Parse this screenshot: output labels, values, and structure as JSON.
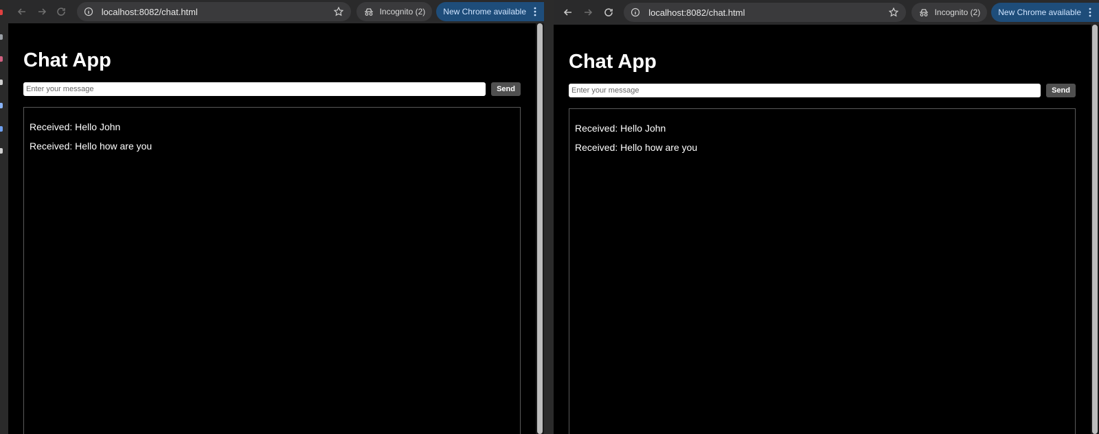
{
  "windows": [
    {
      "url": "localhost:8082/chat.html",
      "incognito_label": "Incognito (2)",
      "update_label": "New Chrome available",
      "app_title": "Chat App",
      "input_placeholder": "Enter your message",
      "send_label": "Send",
      "messages": [
        "Received: Hello John",
        "Received: Hello how are you"
      ]
    },
    {
      "url": "localhost:8082/chat.html",
      "incognito_label": "Incognito (2)",
      "update_label": "New Chrome available",
      "app_title": "Chat App",
      "input_placeholder": "Enter your message",
      "send_label": "Send",
      "messages": [
        "Received: Hello John",
        "Received: Hello how are you"
      ]
    }
  ],
  "icons": {
    "back": "arrow-left-icon",
    "forward": "arrow-right-icon",
    "reload": "reload-icon",
    "site_info": "info-icon",
    "bookmark": "star-icon",
    "incognito": "incognito-icon",
    "menu": "kebab-menu-icon"
  },
  "colors": {
    "toolbar": "#2a2a2b",
    "omnibox": "#3a3a3c",
    "update_chip": "#1e4d7a",
    "page_bg": "#000000",
    "send_button": "#505050"
  }
}
